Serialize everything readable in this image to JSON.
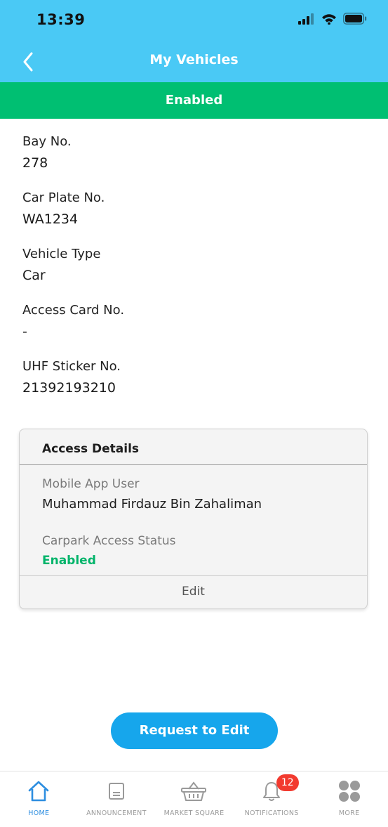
{
  "status_bar": {
    "time": "13:39"
  },
  "nav": {
    "title": "My Vehicles"
  },
  "status_banner": {
    "text": "Enabled",
    "color": "#00bf72"
  },
  "details": [
    {
      "label": "Bay No.",
      "value": "278"
    },
    {
      "label": "Car Plate No.",
      "value": "WA1234"
    },
    {
      "label": "Vehicle Type",
      "value": "Car"
    },
    {
      "label": "Access Card No.",
      "value": "-"
    },
    {
      "label": "UHF Sticker No.",
      "value": "21392193210"
    }
  ],
  "access_card": {
    "title": "Access Details",
    "user_label": "Mobile App User",
    "user_value": "Muhammad Firdauz Bin Zahaliman",
    "status_label": "Carpark Access Status",
    "status_value": "Enabled",
    "edit_label": "Edit"
  },
  "request_button": {
    "label": "Request to Edit",
    "color": "#16a6ec"
  },
  "tabbar": {
    "tabs": [
      {
        "label": "HOME",
        "icon": "home-icon",
        "active": true
      },
      {
        "label": "ANNOUNCEMENT",
        "icon": "announcement-icon"
      },
      {
        "label": "MARKET SQUARE",
        "icon": "basket-icon"
      },
      {
        "label": "NOTIFICATIONS",
        "icon": "bell-icon",
        "badge": "12"
      },
      {
        "label": "MORE",
        "icon": "more-icon"
      }
    ]
  },
  "colors": {
    "header": "#4ac9f5",
    "accent_green": "#00b46a",
    "active_tab": "#2d8ee0"
  }
}
